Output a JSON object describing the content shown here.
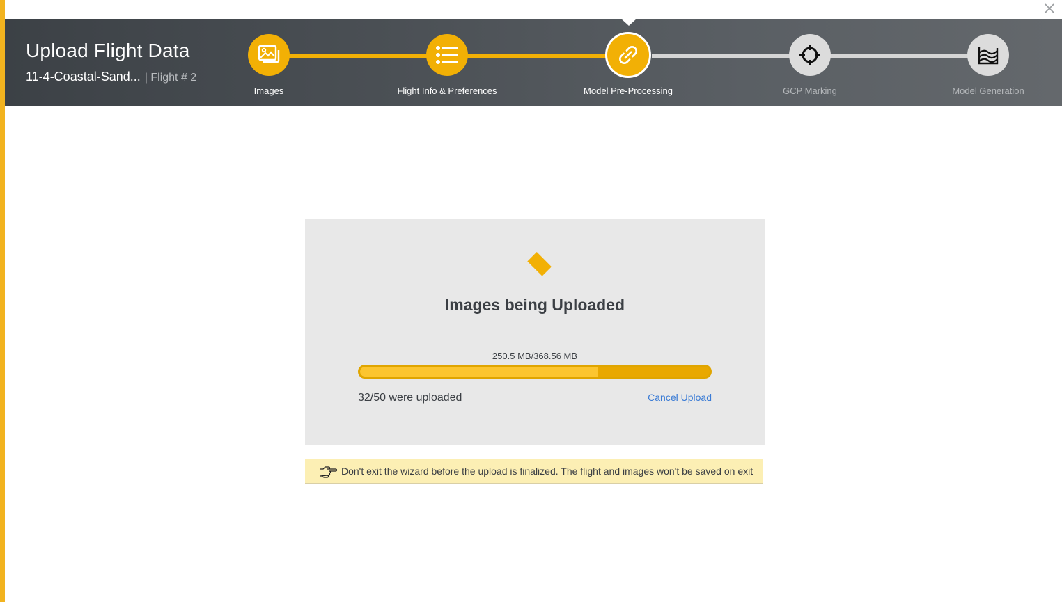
{
  "header": {
    "title": "Upload Flight Data",
    "project_name": "11-4-Coastal-Sand...",
    "flight_label": "| Flight # 2"
  },
  "steps": [
    {
      "label": "Images",
      "icon": "images-icon",
      "state": "done"
    },
    {
      "label": "Flight Info & Preferences",
      "icon": "list-icon",
      "state": "done"
    },
    {
      "label": "Model Pre-Processing",
      "icon": "link-icon",
      "state": "active"
    },
    {
      "label": "GCP Marking",
      "icon": "crosshair-icon",
      "state": "todo"
    },
    {
      "label": "Model Generation",
      "icon": "layers-chart-icon",
      "state": "todo"
    }
  ],
  "upload": {
    "title": "Images being Uploaded",
    "size_text": "250.5 MB/368.56 MB",
    "progress_fraction": 0.68,
    "count_text": "32/50 were uploaded",
    "cancel_label": "Cancel Upload"
  },
  "notice": {
    "text": "Don't exit the wizard before the upload is finalized. The flight and images won't be saved on exit",
    "icon": "pointing-hand-icon"
  },
  "colors": {
    "accent": "#f2b005",
    "header_dark": "#3c4146",
    "link": "#3a7bd5",
    "notice_bg": "#fcefb4"
  }
}
